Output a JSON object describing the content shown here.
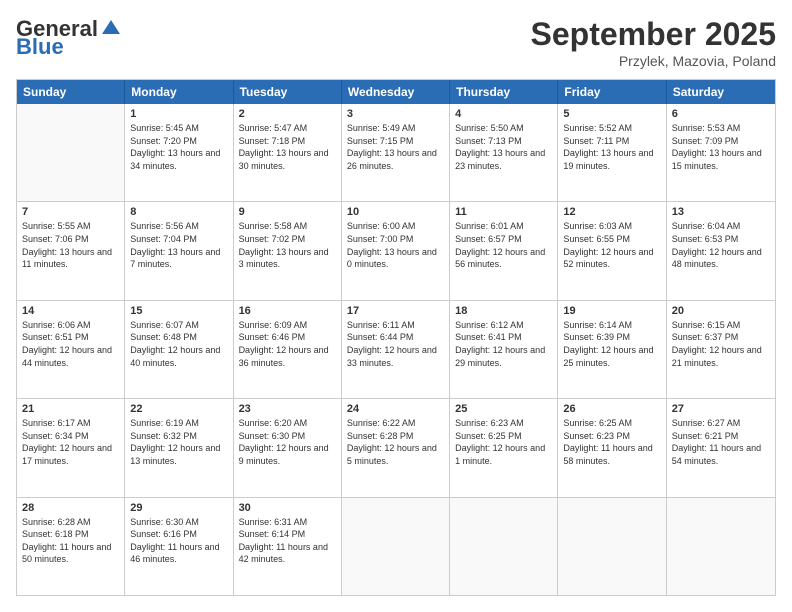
{
  "header": {
    "logo_general": "General",
    "logo_blue": "Blue",
    "month": "September 2025",
    "location": "Przylek, Mazovia, Poland"
  },
  "weekdays": [
    "Sunday",
    "Monday",
    "Tuesday",
    "Wednesday",
    "Thursday",
    "Friday",
    "Saturday"
  ],
  "rows": [
    [
      {
        "day": "",
        "empty": true
      },
      {
        "day": "1",
        "sunrise": "5:45 AM",
        "sunset": "7:20 PM",
        "daylight": "13 hours and 34 minutes."
      },
      {
        "day": "2",
        "sunrise": "5:47 AM",
        "sunset": "7:18 PM",
        "daylight": "13 hours and 30 minutes."
      },
      {
        "day": "3",
        "sunrise": "5:49 AM",
        "sunset": "7:15 PM",
        "daylight": "13 hours and 26 minutes."
      },
      {
        "day": "4",
        "sunrise": "5:50 AM",
        "sunset": "7:13 PM",
        "daylight": "13 hours and 23 minutes."
      },
      {
        "day": "5",
        "sunrise": "5:52 AM",
        "sunset": "7:11 PM",
        "daylight": "13 hours and 19 minutes."
      },
      {
        "day": "6",
        "sunrise": "5:53 AM",
        "sunset": "7:09 PM",
        "daylight": "13 hours and 15 minutes."
      }
    ],
    [
      {
        "day": "7",
        "sunrise": "5:55 AM",
        "sunset": "7:06 PM",
        "daylight": "13 hours and 11 minutes."
      },
      {
        "day": "8",
        "sunrise": "5:56 AM",
        "sunset": "7:04 PM",
        "daylight": "13 hours and 7 minutes."
      },
      {
        "day": "9",
        "sunrise": "5:58 AM",
        "sunset": "7:02 PM",
        "daylight": "13 hours and 3 minutes."
      },
      {
        "day": "10",
        "sunrise": "6:00 AM",
        "sunset": "7:00 PM",
        "daylight": "13 hours and 0 minutes."
      },
      {
        "day": "11",
        "sunrise": "6:01 AM",
        "sunset": "6:57 PM",
        "daylight": "12 hours and 56 minutes."
      },
      {
        "day": "12",
        "sunrise": "6:03 AM",
        "sunset": "6:55 PM",
        "daylight": "12 hours and 52 minutes."
      },
      {
        "day": "13",
        "sunrise": "6:04 AM",
        "sunset": "6:53 PM",
        "daylight": "12 hours and 48 minutes."
      }
    ],
    [
      {
        "day": "14",
        "sunrise": "6:06 AM",
        "sunset": "6:51 PM",
        "daylight": "12 hours and 44 minutes."
      },
      {
        "day": "15",
        "sunrise": "6:07 AM",
        "sunset": "6:48 PM",
        "daylight": "12 hours and 40 minutes."
      },
      {
        "day": "16",
        "sunrise": "6:09 AM",
        "sunset": "6:46 PM",
        "daylight": "12 hours and 36 minutes."
      },
      {
        "day": "17",
        "sunrise": "6:11 AM",
        "sunset": "6:44 PM",
        "daylight": "12 hours and 33 minutes."
      },
      {
        "day": "18",
        "sunrise": "6:12 AM",
        "sunset": "6:41 PM",
        "daylight": "12 hours and 29 minutes."
      },
      {
        "day": "19",
        "sunrise": "6:14 AM",
        "sunset": "6:39 PM",
        "daylight": "12 hours and 25 minutes."
      },
      {
        "day": "20",
        "sunrise": "6:15 AM",
        "sunset": "6:37 PM",
        "daylight": "12 hours and 21 minutes."
      }
    ],
    [
      {
        "day": "21",
        "sunrise": "6:17 AM",
        "sunset": "6:34 PM",
        "daylight": "12 hours and 17 minutes."
      },
      {
        "day": "22",
        "sunrise": "6:19 AM",
        "sunset": "6:32 PM",
        "daylight": "12 hours and 13 minutes."
      },
      {
        "day": "23",
        "sunrise": "6:20 AM",
        "sunset": "6:30 PM",
        "daylight": "12 hours and 9 minutes."
      },
      {
        "day": "24",
        "sunrise": "6:22 AM",
        "sunset": "6:28 PM",
        "daylight": "12 hours and 5 minutes."
      },
      {
        "day": "25",
        "sunrise": "6:23 AM",
        "sunset": "6:25 PM",
        "daylight": "12 hours and 1 minute."
      },
      {
        "day": "26",
        "sunrise": "6:25 AM",
        "sunset": "6:23 PM",
        "daylight": "11 hours and 58 minutes."
      },
      {
        "day": "27",
        "sunrise": "6:27 AM",
        "sunset": "6:21 PM",
        "daylight": "11 hours and 54 minutes."
      }
    ],
    [
      {
        "day": "28",
        "sunrise": "6:28 AM",
        "sunset": "6:18 PM",
        "daylight": "11 hours and 50 minutes."
      },
      {
        "day": "29",
        "sunrise": "6:30 AM",
        "sunset": "6:16 PM",
        "daylight": "11 hours and 46 minutes."
      },
      {
        "day": "30",
        "sunrise": "6:31 AM",
        "sunset": "6:14 PM",
        "daylight": "11 hours and 42 minutes."
      },
      {
        "day": "",
        "empty": true
      },
      {
        "day": "",
        "empty": true
      },
      {
        "day": "",
        "empty": true
      },
      {
        "day": "",
        "empty": true
      }
    ]
  ]
}
